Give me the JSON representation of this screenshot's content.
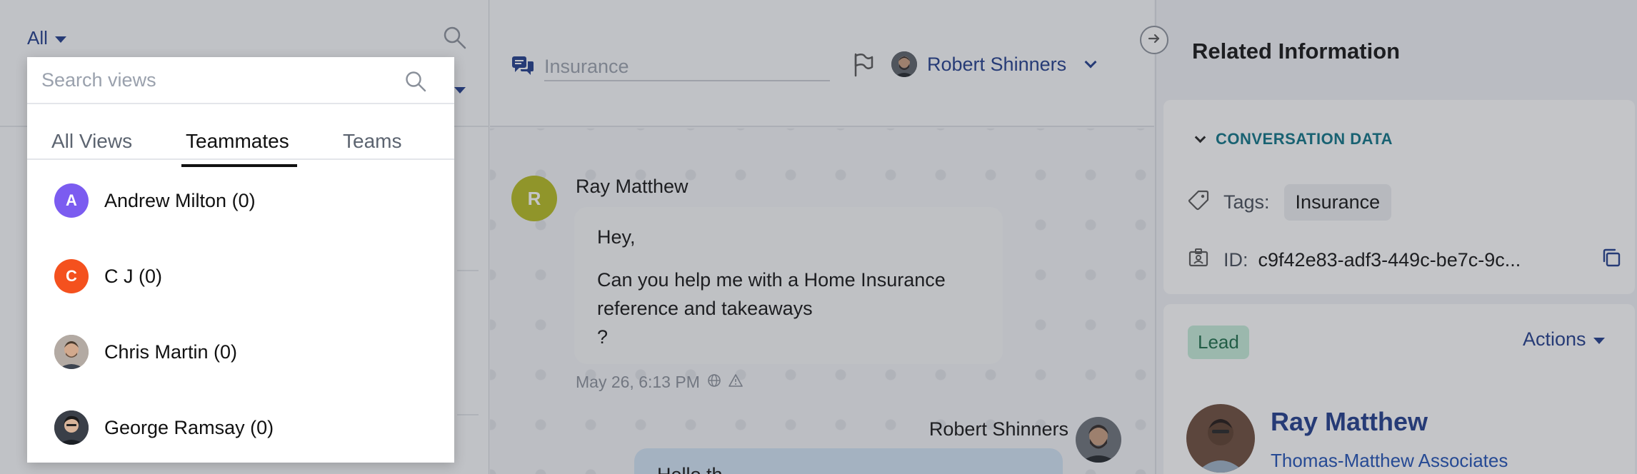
{
  "left_panel": {
    "filter_label": "All"
  },
  "conversation": {
    "subject_placeholder": "Insurance",
    "assignee_name": "Robert Shinners",
    "messages": [
      {
        "sender": "Ray Matthew",
        "avatar_initial": "R",
        "avatar_color": "#b5bb1e",
        "lines": [
          "Hey,",
          "Can you help me with a Home Insurance reference and takeaways",
          "?"
        ],
        "timestamp": "May 26, 6:13 PM"
      },
      {
        "sender": "Robert Shinners",
        "text": "Hello th"
      }
    ]
  },
  "related": {
    "title": "Related Information",
    "conversation_data": {
      "heading": "CONVERSATION DATA",
      "tags_label": "Tags:",
      "tag": "Insurance",
      "id_label": "ID:",
      "id_value": "c9f42e83-adf3-449c-be7c-9c..."
    },
    "contact": {
      "badge": "Lead",
      "actions_label": "Actions",
      "name": "Ray Matthew",
      "company": "Thomas-Matthew Associates"
    }
  },
  "views_dropdown": {
    "search_placeholder": "Search views",
    "tabs": [
      "All Views",
      "Teammates",
      "Teams"
    ],
    "active_tab": "Teammates",
    "teammates": [
      {
        "name": "Andrew Milton (0)",
        "initial": "A",
        "avatar_color": "#7b5cf0",
        "photo": false
      },
      {
        "name": "C J (0)",
        "initial": "C",
        "avatar_color": "#f4511e",
        "photo": false
      },
      {
        "name": "Chris Martin (0)",
        "initial": "",
        "avatar_color": "#a89c94",
        "photo": true
      },
      {
        "name": "George Ramsay (0)",
        "initial": "",
        "avatar_color": "#2f3542",
        "photo": true
      }
    ]
  },
  "colors": {
    "brand_blue": "#1e3a8a",
    "teal_heading": "#0b7285",
    "lead_badge_bg": "#c5ecd9",
    "overlay": "rgba(60,64,72,0.30)"
  }
}
